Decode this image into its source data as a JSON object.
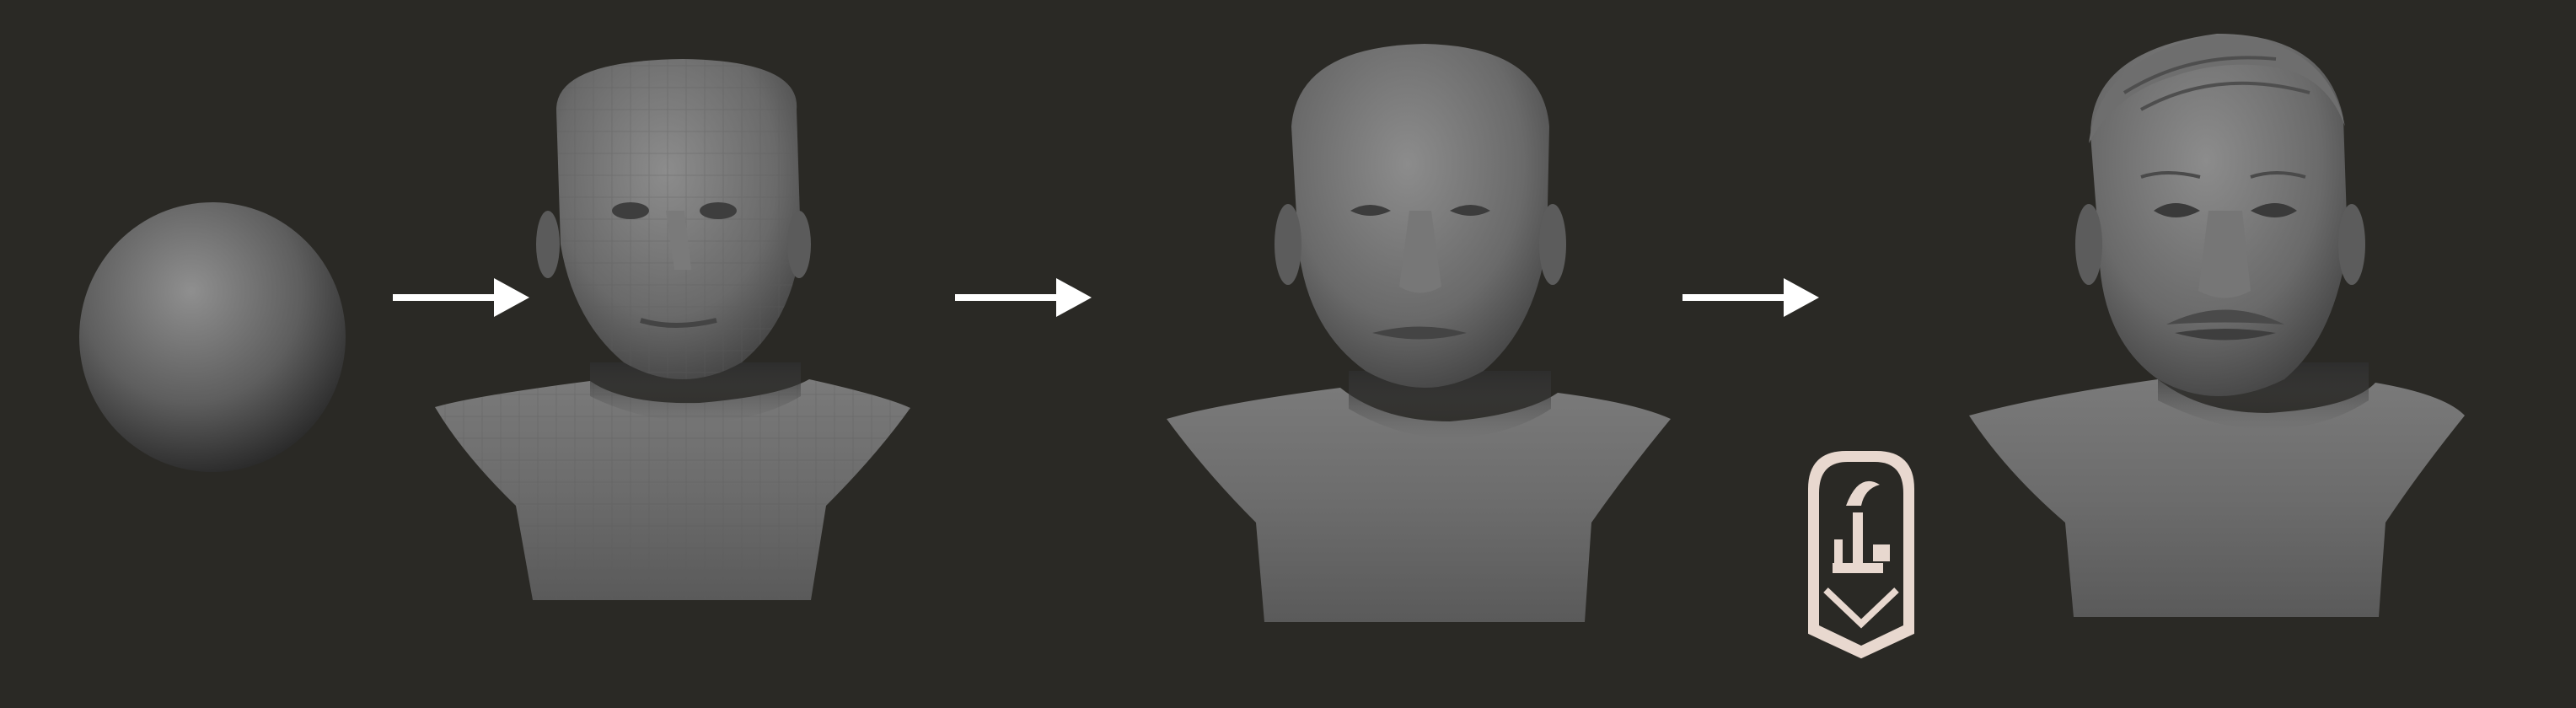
{
  "scene": {
    "background_color": "#2a2925",
    "sequence": [
      {
        "name": "sphere",
        "stage": "primitive"
      },
      {
        "name": "blockout-bust",
        "stage": "low-poly"
      },
      {
        "name": "smooth-bust",
        "stage": "refined"
      },
      {
        "name": "detailed-bust",
        "stage": "final"
      }
    ],
    "arrow_color": "#ffffff",
    "clay_color": "#8a8a8a",
    "logo": {
      "name": "arabic-calligraphy-emblem",
      "color": "#e8d8cf",
      "text": "فن"
    }
  }
}
